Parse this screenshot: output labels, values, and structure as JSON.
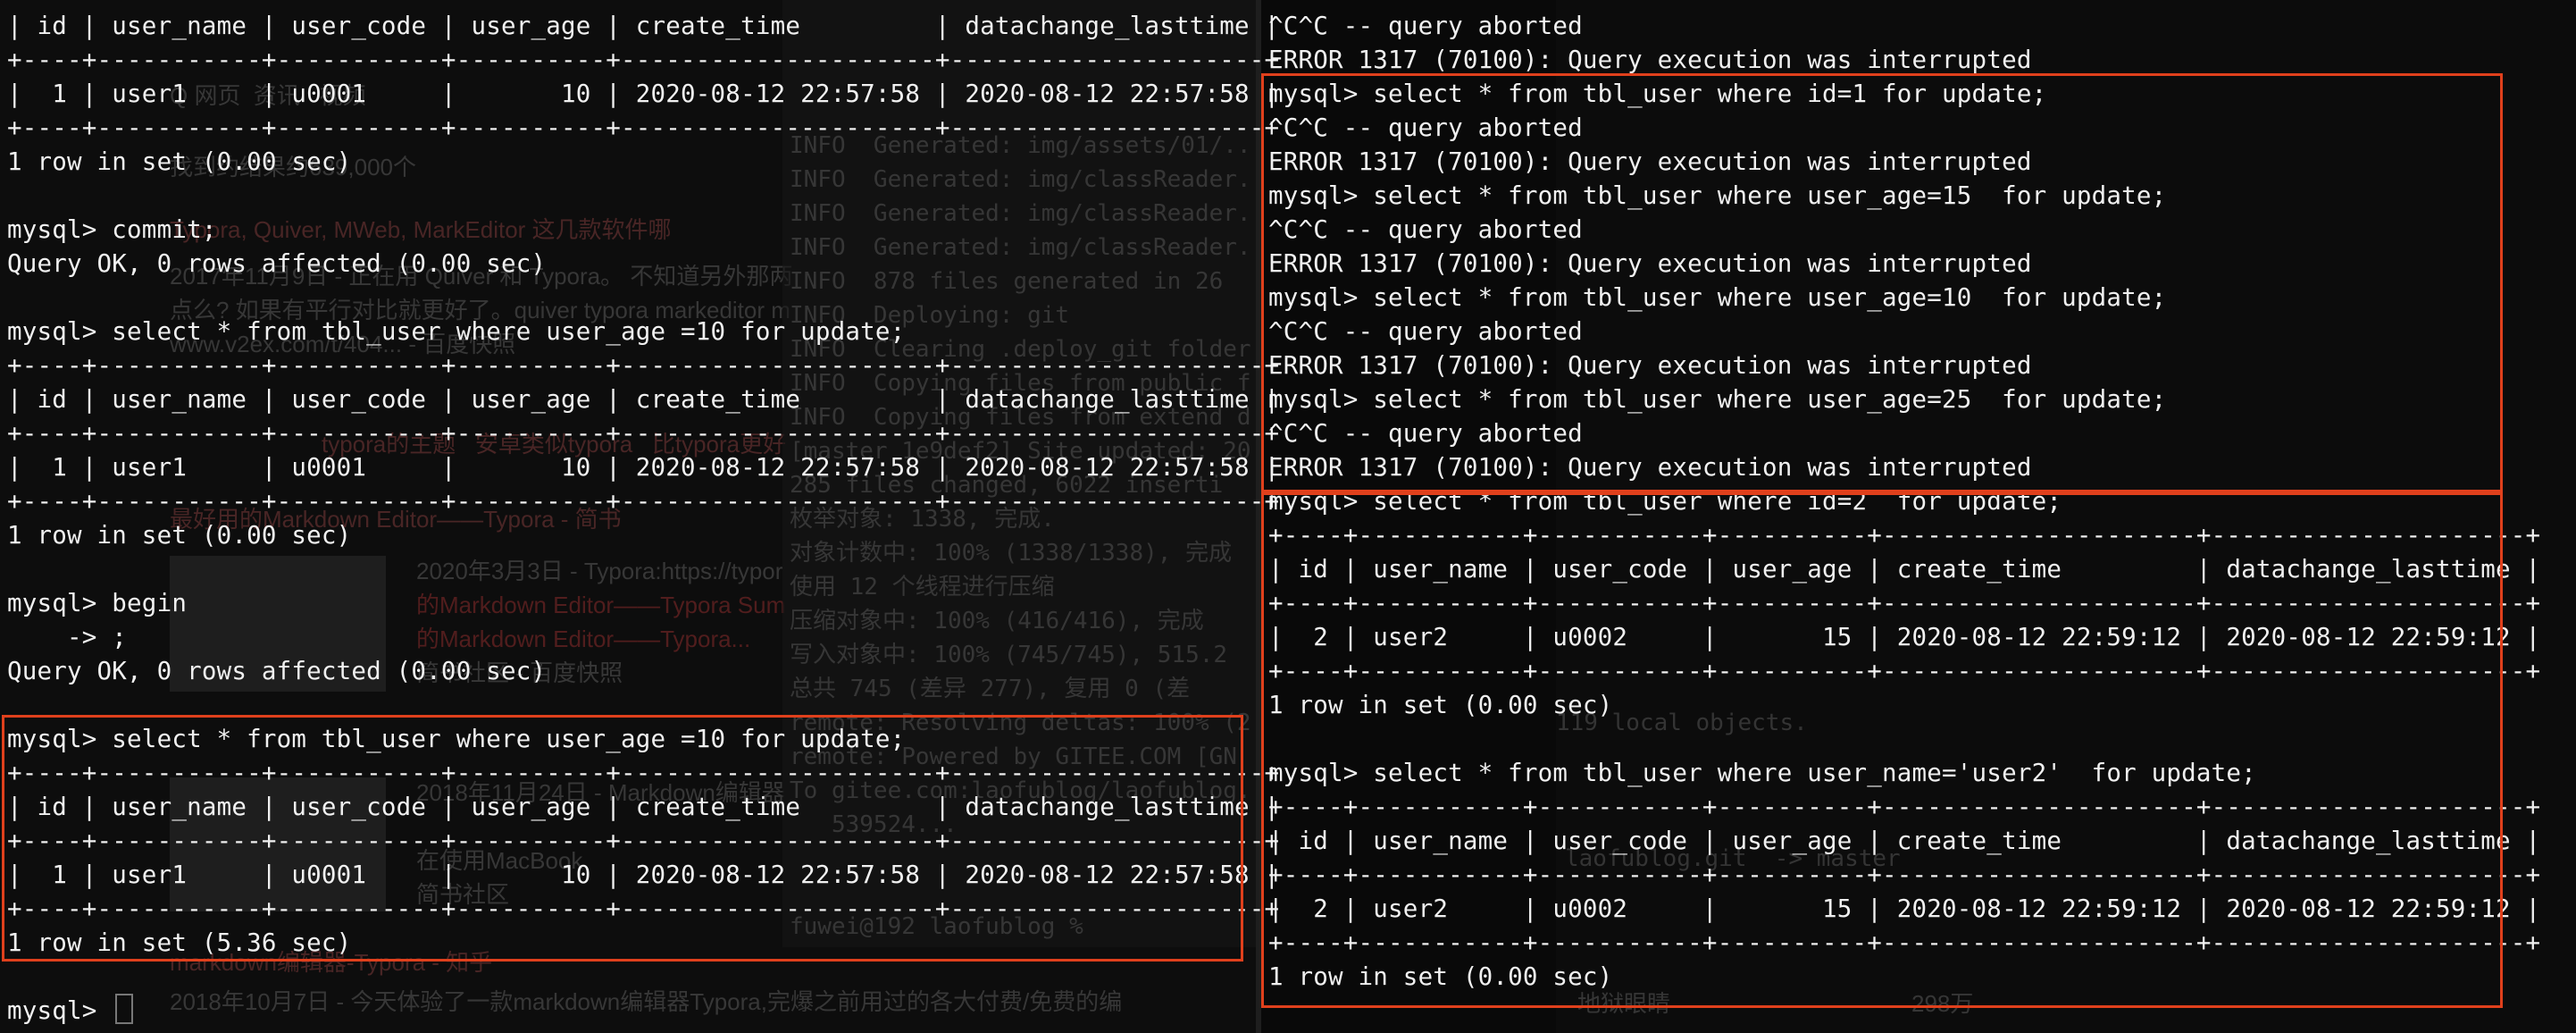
{
  "left_terminal": {
    "lines": [
      "| id | user_name | user_code | user_age | create_time         | datachange_lasttime |",
      "+----+-----------+-----------+----------+---------------------+---------------------+",
      "|  1 | user1     | u0001     |       10 | 2020-08-12 22:57:58 | 2020-08-12 22:57:58 |",
      "+----+-----------+-----------+----------+---------------------+---------------------+",
      "1 row in set (0.00 sec)",
      "",
      "mysql> commit;",
      "Query OK, 0 rows affected (0.00 sec)",
      "",
      "mysql> select * from tbl_user where user_age =10 for update;",
      "+----+-----------+-----------+----------+---------------------+---------------------+",
      "| id | user_name | user_code | user_age | create_time         | datachange_lasttime |",
      "+----+-----------+-----------+----------+---------------------+---------------------+",
      "|  1 | user1     | u0001     |       10 | 2020-08-12 22:57:58 | 2020-08-12 22:57:58 |",
      "+----+-----------+-----------+----------+---------------------+---------------------+",
      "1 row in set (0.00 sec)",
      "",
      "mysql> begin",
      "    -> ;",
      "Query OK, 0 rows affected (0.00 sec)",
      "",
      "mysql> select * from tbl_user where user_age =10 for update;",
      "+----+-----------+-----------+----------+---------------------+---------------------+",
      "| id | user_name | user_code | user_age | create_time         | datachange_lasttime |",
      "+----+-----------+-----------+----------+---------------------+---------------------+",
      "|  1 | user1     | u0001     |       10 | 2020-08-12 22:57:58 | 2020-08-12 22:57:58 |",
      "+----+-----------+-----------+----------+---------------------+---------------------+",
      "1 row in set (5.36 sec)",
      ""
    ],
    "prompt": "mysql> "
  },
  "right_terminal": {
    "lines": [
      "^C^C -- query aborted",
      "ERROR 1317 (70100): Query execution was interrupted",
      "mysql> select * from tbl_user where id=1 for update;",
      "^C^C -- query aborted",
      "ERROR 1317 (70100): Query execution was interrupted",
      "mysql> select * from tbl_user where user_age=15  for update;",
      "^C^C -- query aborted",
      "ERROR 1317 (70100): Query execution was interrupted",
      "mysql> select * from tbl_user where user_age=10  for update;",
      "^C^C -- query aborted",
      "ERROR 1317 (70100): Query execution was interrupted",
      "mysql> select * from tbl_user where user_age=25  for update;",
      "^C^C -- query aborted",
      "ERROR 1317 (70100): Query execution was interrupted",
      "mysql> select * from tbl_user where id=2  for update;",
      "+----+-----------+-----------+----------+---------------------+---------------------+",
      "| id | user_name | user_code | user_age | create_time         | datachange_lasttime |",
      "+----+-----------+-----------+----------+---------------------+---------------------+",
      "|  2 | user2     | u0002     |       15 | 2020-08-12 22:59:12 | 2020-08-12 22:59:12 |",
      "+----+-----------+-----------+----------+---------------------+---------------------+",
      "1 row in set (0.00 sec)",
      "",
      "mysql> select * from tbl_user where user_name='user2'  for update;",
      "+----+-----------+-----------+----------+---------------------+---------------------+",
      "| id | user_name | user_code | user_age | create_time         | datachange_lasttime |",
      "+----+-----------+-----------+----------+---------------------+---------------------+",
      "|  2 | user2     | u0002     |       15 | 2020-08-12 22:59:12 | 2020-08-12 22:59:12 |",
      "+----+-----------+-----------+----------+---------------------+---------------------+",
      "1 row in set (0.00 sec)"
    ]
  },
  "background_ghost": {
    "left_browser": [
      "Q 网页  资讯   视频",
      "找到约结果约639,000个",
      "Typora, Quiver, MWeb, MarkEditor 这几款软件哪",
      "2017年11月9日 - 正在用 Quiver 和 Typora。 不知道另外那两",
      "点么? 如果有平行对比就更好了。quiver typora markeditor m",
      "www.v2ex.com/t/404... - 百度快照",
      "typora的主题   安卓类似typora   比typora更好",
      "最好用的Markdown Editor——Typora - 简书",
      "2020年3月3日 - Typora:https://typor",
      "的Markdown Editor——Typora Sum",
      "的Markdown Editor——Typora...",
      "简书社区 - 百度快照",
      "2018年11月24日 - Markdown编辑器",
      "在使用MacBook",
      "简书社区",
      "markdown编辑器-Typora - 知乎",
      "2018年10月7日 - 今天体验了一款markdown编辑器Typora,完爆之前用过的各大付费/免费的编"
    ],
    "middle_terminal": [
      "INFO  Generated: img/assets/01/...",
      "INFO  Generated: img/classReader...",
      "INFO  Generated: img/classReader...",
      "INFO  Generated: img/classReader...",
      "INFO  878 files generated in 26",
      "INFO  Deploying: git",
      "INFO  Clearing .deploy_git folder",
      "INFO  Copying files from public f",
      "INFO  Copying files from extend d",
      "[master 1e9def2] Site updated: 20",
      "285 files changed, 6022 inserti",
      "枚举对象: 1338, 完成.",
      "对象计数中: 100% (1338/1338), 完成",
      "使用 12 个线程进行压缩",
      "压缩对象中: 100% (416/416), 完成",
      "写入对象中: 100% (745/745), 515.2",
      "总共 745 (差异 277), 复用 0 (差",
      "remote: Resolving deltas: 100% (2",
      "remote: Powered by GITEE.COM [GN",
      "To gitee.com:laofublog/laofublog.",
      "   539524...",
      "fuwei@192 laofublog %"
    ],
    "right_misc": [
      "119 local objects.",
      "laofublog.git  -> master",
      "地狱眼睛",
      "298万"
    ]
  }
}
